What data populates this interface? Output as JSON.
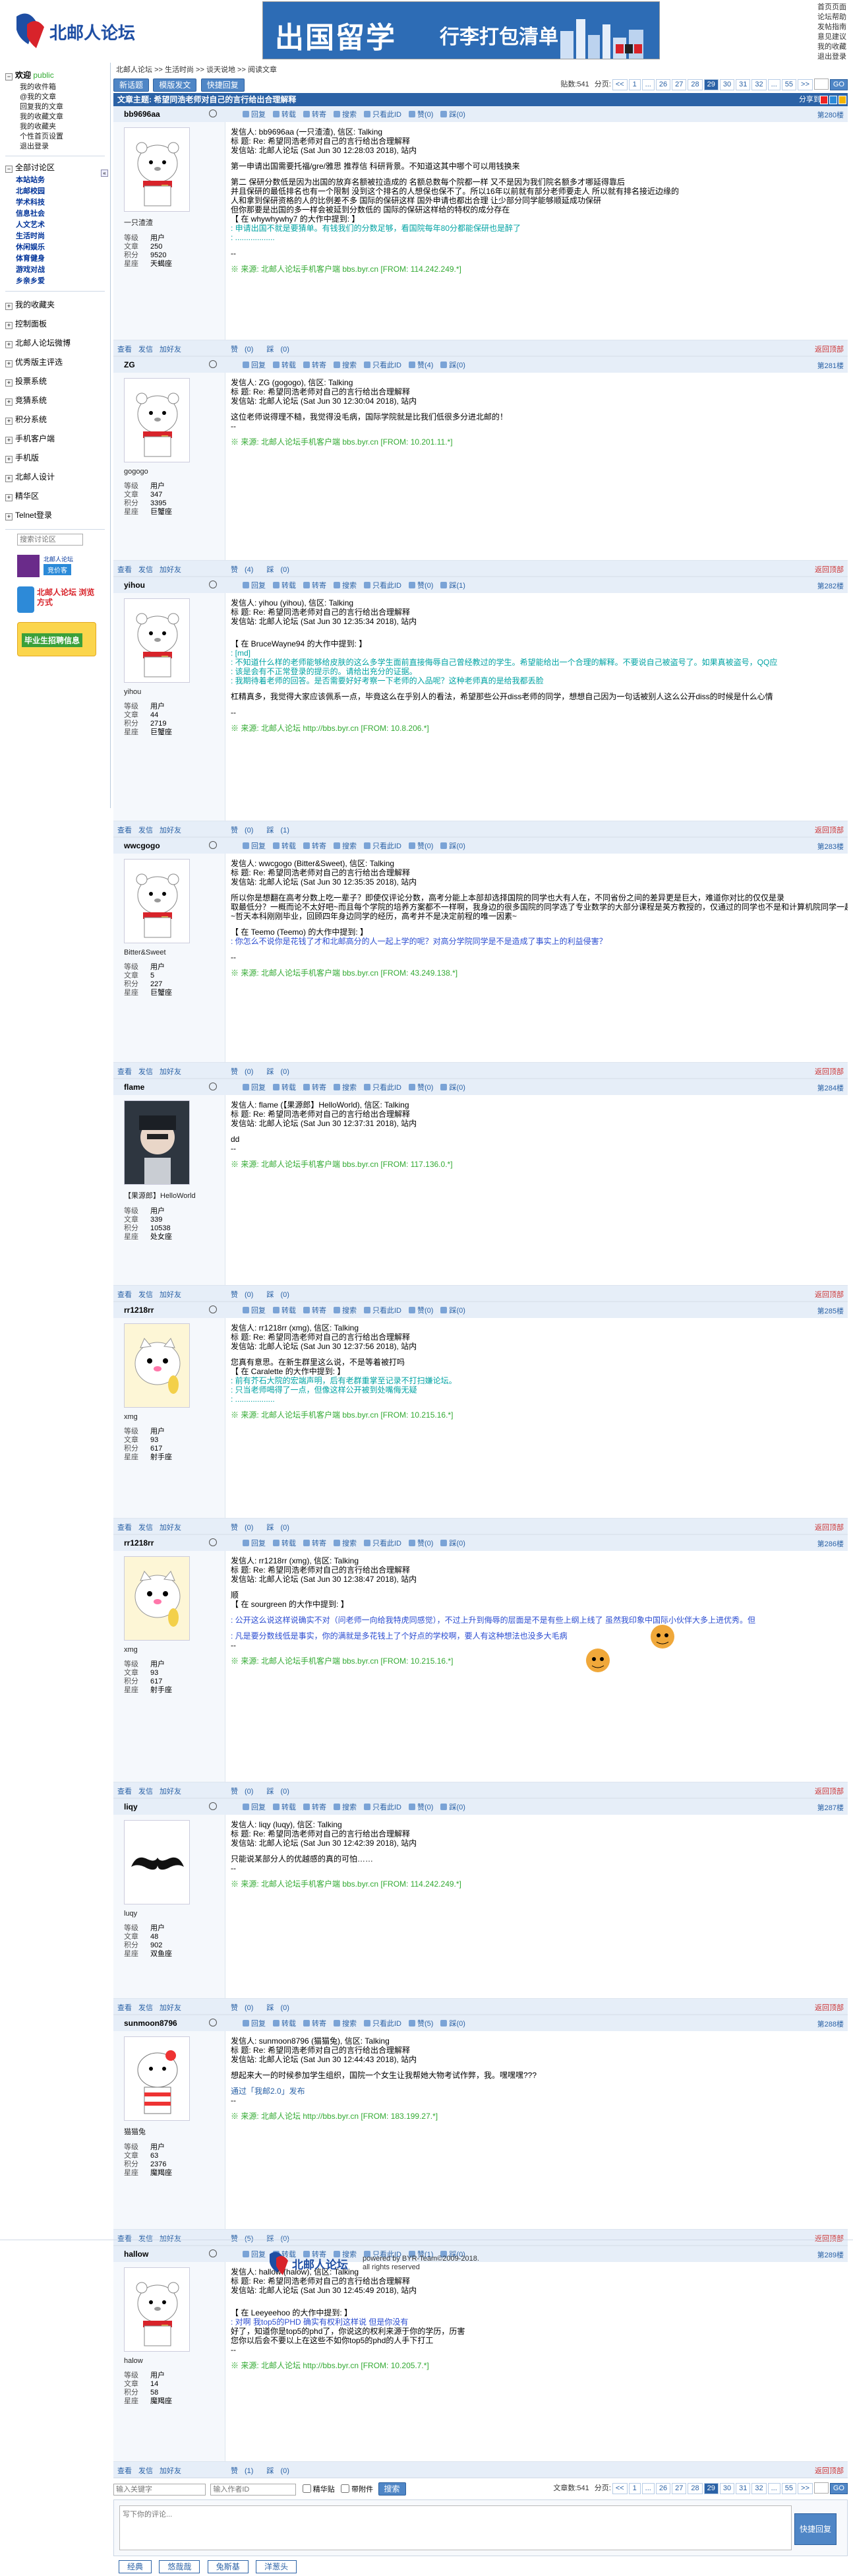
{
  "site": {
    "logo_text": "北邮人论坛",
    "banner": {
      "big": "出国留学",
      "small": "行李打包清单"
    },
    "top_links": [
      "首页页面",
      "论坛帮助",
      "发帖指南",
      "意见建议",
      "我的收藏",
      "退出登录"
    ]
  },
  "sidebar": {
    "welcome": "欢迎",
    "user": "public",
    "user_links": [
      "我的收件箱",
      "@我的文章",
      "回复我的文章",
      "我的收藏文章",
      "我的收藏夹",
      "个性首页设置",
      "退出登录"
    ],
    "sections_title": "全部讨论区",
    "sections": [
      "本站站务",
      "北邮校园",
      "学术科技",
      "信息社会",
      "人文艺术",
      "生活时尚",
      "休闲娱乐",
      "体育健身",
      "游戏对战",
      "乡亲乡爱"
    ],
    "menu": [
      "我的收藏夹",
      "控制面板",
      "北邮人论坛微博",
      "优秀版主评选",
      "投票系统",
      "竞猜系统",
      "积分系统",
      "手机客户端",
      "手机版",
      "北邮人设计",
      "精华区",
      "Telnet登录"
    ],
    "search_placeholder": "搜索讨论区",
    "ad1": "北邮人论坛",
    "ad1_btn": "竞价客",
    "ad2": "北邮人论坛 浏览方式",
    "ad3": "毕业生招聘信息"
  },
  "breadcrumb": [
    "北邮人论坛",
    ">>",
    "生活时尚",
    ">>",
    "谈天说地",
    ">>",
    "阅读文章"
  ],
  "toolbar": {
    "new": "新话题",
    "tpl": "模版发文",
    "quick": "快捷回复"
  },
  "pager": {
    "count_label": "贴数:541",
    "page_label": "分页:",
    "prev": "<<",
    "pages": [
      "1",
      "...",
      "26",
      "27",
      "28",
      "29",
      "30",
      "31",
      "32",
      "...",
      "55"
    ],
    "current": "29",
    "next": ">>",
    "go": "GO"
  },
  "thread": {
    "title": "文章主题: 希望同浩老师对自己的言行给出合理解释",
    "share": "分享到:"
  },
  "acts": [
    "回复",
    "转载",
    "转寄",
    "搜索",
    "只看此ID",
    "赞",
    "踩"
  ],
  "foot_left": [
    "查看",
    "发信",
    "加好友"
  ],
  "back_top": "返回顶部",
  "stat_labels": [
    "等级",
    "文章",
    "积分",
    "星座"
  ],
  "posts": [
    {
      "uid": "bb9696aa",
      "floor": "第280楼",
      "nick": "一只渣渣",
      "stats": [
        "用户",
        "250",
        "9520",
        "天蝎座"
      ],
      "up": "(0)",
      "down": "(0)",
      "fu": "(0)",
      "fd": "(0)",
      "lines": [
        {
          "c": "l",
          "t": "发信人: bb9696aa (一只渣渣), 信区: Talking"
        },
        {
          "c": "l",
          "t": "标 题: Re: 希望同浩老师对自己的言行给出合理解释"
        },
        {
          "c": "l",
          "t": "发信站: 北邮人论坛 (Sat Jun 30 12:28:03 2018), 站内"
        },
        {
          "c": "g",
          "t": ""
        },
        {
          "c": "l",
          "t": "第一申请出国需要托福/gre/雅思 推荐信 科研背景。不知道这其中哪个可以用钱换来"
        },
        {
          "c": "g",
          "t": ""
        },
        {
          "c": "l",
          "t": "第二 保研分数低是因为出国的放弃名额被拉造成的 名额总数每个院都一样 又不是因为我们院名额多才哪延得靠后"
        },
        {
          "c": "l",
          "t": "并且保研的最低排名也有一个限制 没到这个排名的人想保也保不了。所以16年以前就有部分老师要走人 所以就有排名接近边缘的"
        },
        {
          "c": "l",
          "t": "人和拿到保研资格的人的比例差不多 国际的保研这样 国外申请也都出合理 让少部分同学能够顺延成功保研"
        },
        {
          "c": "l",
          "t": "但你那要是出国的多一样会被延到分数低的 国际的保研这样给的特权的成分存在"
        },
        {
          "c": "l",
          "t": "【 在 whywhywhy7 的大作中提到: 】"
        },
        {
          "c": "q",
          "t": ": 申请出国不就是要猜单。有钱我们的分数足够，看国院每年80分都能保研也是醉了"
        },
        {
          "c": "q",
          "t": ": .................."
        },
        {
          "c": "g",
          "t": ""
        },
        {
          "c": "l",
          "t": "--"
        },
        {
          "c": "g",
          "t": ""
        },
        {
          "c": "src",
          "t": "※ 来源: 北邮人论坛手机客户端 bbs.byr.cn [FROM: 114.242.249.*]"
        }
      ]
    },
    {
      "uid": "ZG",
      "floor": "第281楼",
      "nick": "gogogo",
      "stats": [
        "用户",
        "347",
        "3395",
        "巨蟹座"
      ],
      "up": "(4)",
      "down": "(0)",
      "fu": "(4)",
      "fd": "(0)",
      "lines": [
        {
          "c": "l",
          "t": "发信人: ZG (gogogo), 信区: Talking"
        },
        {
          "c": "l",
          "t": "标 题: Re: 希望同浩老师对自己的言行给出合理解释"
        },
        {
          "c": "l",
          "t": "发信站: 北邮人论坛 (Sat Jun 30 12:30:04 2018), 站内"
        },
        {
          "c": "g",
          "t": ""
        },
        {
          "c": "l",
          "t": "这位老师说得理不糙，我觉得没毛病，国际学院就是比我们低很多分进北邮的！"
        },
        {
          "c": "l",
          "t": "--"
        },
        {
          "c": "g",
          "t": ""
        },
        {
          "c": "src",
          "t": "※ 来源: 北邮人论坛手机客户端 bbs.byr.cn [FROM: 10.201.11.*]"
        }
      ]
    },
    {
      "uid": "yihou",
      "floor": "第282楼",
      "nick": "yihou",
      "stats": [
        "用户",
        "44",
        "2719",
        "巨蟹座"
      ],
      "up": "(0)",
      "down": "(1)",
      "fu": "(0)",
      "fd": "(1)",
      "lines": [
        {
          "c": "l",
          "t": "发信人: yihou (yihou), 信区: Talking"
        },
        {
          "c": "l",
          "t": "标 题: Re: 希望同浩老师对自己的言行给出合理解释"
        },
        {
          "c": "l",
          "t": "发信站: 北邮人论坛 (Sat Jun 30 12:35:34 2018), 站内"
        },
        {
          "c": "g",
          "t": ""
        },
        {
          "c": "g",
          "t": ""
        },
        {
          "c": "l",
          "t": "【 在 BruceWayne94 的大作中提到: 】"
        },
        {
          "c": "q",
          "t": ": [md]"
        },
        {
          "c": "q",
          "t": ": 不知道什么样的老师能够给皮肤的这么多学生面前直接侮辱自己曾经教过的学生。希望能给出一个合理的解释。不要说自己被盗号了。如果真被盗号，QQ应"
        },
        {
          "c": "q",
          "t": ": 该是会有不正常登录的提示的。请给出充分的证据。"
        },
        {
          "c": "q",
          "t": ": 我期待着老师的回答。是否需要好好考察一下老师的入品呢？这种老师真的是给我都丢脸"
        },
        {
          "c": "g",
          "t": ""
        },
        {
          "c": "l",
          "t": "杠精真多，我觉得大家应该佩系一点，毕竟这么在乎别人的看法，希望那些公开diss老师的同学，想想自己因为一句话被别人这么公开diss的时候是什么心情"
        },
        {
          "c": "g",
          "t": ""
        },
        {
          "c": "l",
          "t": "--"
        },
        {
          "c": "g",
          "t": ""
        },
        {
          "c": "src",
          "t": "※ 来源: 北邮人论坛 http://bbs.byr.cn [FROM: 10.8.206.*]"
        }
      ]
    },
    {
      "uid": "wwcgogo",
      "floor": "第283楼",
      "nick": "Bitter&Sweet",
      "stats": [
        "用户",
        "5",
        "227",
        "巨蟹座"
      ],
      "up": "(0)",
      "down": "(0)",
      "fu": "(0)",
      "fd": "(0)",
      "lines": [
        {
          "c": "l",
          "t": "发信人: wwcgogo (Bitter&Sweet), 信区: Talking"
        },
        {
          "c": "l",
          "t": "标 题: Re: 希望同浩老师对自己的言行给出合理解释"
        },
        {
          "c": "l",
          "t": "发信站: 北邮人论坛 (Sat Jun 30 12:35:35 2018), 站内"
        },
        {
          "c": "g",
          "t": ""
        },
        {
          "c": "l",
          "t": "所以你是想翻在高考分数上吃一辈子？即使仅评论分数，高考分能上本部却选择国院的同学也大有人在，不同省份之间的差异更是巨大，难道你对比的仅仅是录"
        },
        {
          "c": "l",
          "t": "取最低分？一概而论不太好吧~而且每个学院的培养方案都不一样啊，我身边的很多国院的同学选了专业数学的大部分课程是英方教授的，仅通过的同学也不是和计算机院同学一起上课的吧"
        },
        {
          "c": "l",
          "t": "~哲天本科刚刚毕业，回顾四年身边同学的经历，高考并不是决定前程的唯一因素~"
        },
        {
          "c": "g",
          "t": ""
        },
        {
          "c": "l",
          "t": "【 在 Teemo (Teemo) 的大作中提到: 】"
        },
        {
          "c": "q2",
          "t": ": 你怎么不说你是花钱了才和北邮高分的人一起上学的呢？对高分学院同学是不是造成了事实上的利益侵害？"
        },
        {
          "c": "g",
          "t": ""
        },
        {
          "c": "l",
          "t": "--"
        },
        {
          "c": "g",
          "t": ""
        },
        {
          "c": "src",
          "t": "※ 来源: 北邮人论坛手机客户端 bbs.byr.cn [FROM: 43.249.138.*]"
        }
      ]
    },
    {
      "uid": "flame",
      "floor": "第284楼",
      "nick": "【果源郎】HelloWorld",
      "stats": [
        "用户",
        "339",
        "10538",
        "处女座"
      ],
      "up": "(0)",
      "down": "(0)",
      "fu": "(0)",
      "fd": "(0)",
      "lines": [
        {
          "c": "l",
          "t": "发信人: flame (【果源郎】HelloWorld), 信区: Talking"
        },
        {
          "c": "l",
          "t": "标 题: Re: 希望同浩老师对自己的言行给出合理解释"
        },
        {
          "c": "l",
          "t": "发信站: 北邮人论坛 (Sat Jun 30 12:37:31 2018), 站内"
        },
        {
          "c": "g",
          "t": ""
        },
        {
          "c": "l",
          "t": "dd"
        },
        {
          "c": "l",
          "t": "--"
        },
        {
          "c": "g",
          "t": ""
        },
        {
          "c": "src",
          "t": "※ 来源: 北邮人论坛手机客户端 bbs.byr.cn [FROM: 117.136.0.*]"
        }
      ]
    },
    {
      "uid": "rr1218rr",
      "floor": "第285楼",
      "nick": "xmg",
      "stats": [
        "用户",
        "93",
        "617",
        "射手座"
      ],
      "up": "(0)",
      "down": "(0)",
      "fu": "(0)",
      "fd": "(0)",
      "lines": [
        {
          "c": "l",
          "t": "发信人: rr1218rr (xmg), 信区: Talking"
        },
        {
          "c": "l",
          "t": "标 题: Re: 希望同浩老师对自己的言行给出合理解释"
        },
        {
          "c": "l",
          "t": "发信站: 北邮人论坛 (Sat Jun 30 12:37:56 2018), 站内"
        },
        {
          "c": "g",
          "t": ""
        },
        {
          "c": "l",
          "t": "您真有意思。在新生群里这么说，不是等着被打吗"
        },
        {
          "c": "l",
          "t": "【 在 Caralette 的大作中提到: 】"
        },
        {
          "c": "q",
          "t": ": 前有芥石大院的宏端声明，后有老群重掌至记录不打扫嫌论坛。"
        },
        {
          "c": "q",
          "t": ": 只当老师喝得了一点，但像这样公开被到处嘴侮无疑"
        },
        {
          "c": "q",
          "t": ": .................."
        },
        {
          "c": "g",
          "t": ""
        },
        {
          "c": "src",
          "t": "※ 来源: 北邮人论坛手机客户端 bbs.byr.cn [FROM: 10.215.16.*]"
        }
      ]
    },
    {
      "uid": "rr1218rr",
      "floor": "第286楼",
      "nick": "xmg",
      "stats": [
        "用户",
        "93",
        "617",
        "射手座"
      ],
      "up": "(0)",
      "down": "(0)",
      "fu": "(0)",
      "fd": "(0)",
      "lines": [
        {
          "c": "l",
          "t": "发信人: rr1218rr (xmg), 信区: Talking"
        },
        {
          "c": "l",
          "t": "标 题: Re: 希望同浩老师对自己的言行给出合理解释"
        },
        {
          "c": "l",
          "t": "发信站: 北邮人论坛 (Sat Jun 30 12:38:47 2018), 站内"
        },
        {
          "c": "g",
          "t": ""
        },
        {
          "c": "l",
          "t": "顺"
        },
        {
          "c": "l",
          "t": "【 在 sourgreen 的大作中提到: 】"
        },
        {
          "c": "g",
          "t": ""
        },
        {
          "c": "q2",
          "t": ": 公开这么说这样说确实不对（问老师一向给我特虎同感觉），不过上升到侮辱的层面是不是有些上纲上线了       虽然我印象中国际小伙伴大多上进优秀。但"
        },
        {
          "c": "g",
          "t": ""
        },
        {
          "c": "q2",
          "t": ": 凡是要分数线低是事实，你的满就是多花钱上了个好点的学校啊，要人有这种想法也没多大毛病"
        },
        {
          "c": "l",
          "t": "--"
        },
        {
          "c": "g",
          "t": ""
        },
        {
          "c": "src",
          "t": "※ 来源: 北邮人论坛手机客户端 bbs.byr.cn [FROM: 10.215.16.*]"
        }
      ]
    },
    {
      "uid": "liqy",
      "floor": "第287楼",
      "nick": "luqy",
      "stats": [
        "用户",
        "48",
        "902",
        "双鱼座"
      ],
      "up": "(0)",
      "down": "(0)",
      "fu": "(0)",
      "fd": "(0)",
      "lines": [
        {
          "c": "l",
          "t": "发信人: liqy (luqy), 信区: Talking"
        },
        {
          "c": "l",
          "t": "标 题: Re: 希望同浩老师对自己的言行给出合理解释"
        },
        {
          "c": "l",
          "t": "发信站: 北邮人论坛 (Sat Jun 30 12:42:39 2018), 站内"
        },
        {
          "c": "g",
          "t": ""
        },
        {
          "c": "l",
          "t": "只能说某部分人的优越感的真的可怕……"
        },
        {
          "c": "l",
          "t": "--"
        },
        {
          "c": "g",
          "t": ""
        },
        {
          "c": "src",
          "t": "※ 来源: 北邮人论坛手机客户端 bbs.byr.cn [FROM: 114.242.249.*]"
        }
      ]
    },
    {
      "uid": "sunmoon8796",
      "floor": "第288楼",
      "nick": "猫猫兔",
      "stats": [
        "用户",
        "63",
        "2376",
        "魔羯座"
      ],
      "up": "(5)",
      "down": "(0)",
      "fu": "(5)",
      "fd": "(0)",
      "lines": [
        {
          "c": "l",
          "t": "发信人: sunmoon8796 (猫猫兔), 信区: Talking"
        },
        {
          "c": "l",
          "t": "标 题: Re: 希望同浩老师对自己的言行给出合理解释"
        },
        {
          "c": "l",
          "t": "发信站: 北邮人论坛 (Sat Jun 30 12:44:43 2018), 站内"
        },
        {
          "c": "g",
          "t": ""
        },
        {
          "c": "l",
          "t": "想起来大一的时候参加学生组织，国院一个女生让我帮她大物考试作弊，我。嘿嘿嘿???"
        },
        {
          "c": "g",
          "t": ""
        },
        {
          "c": "blue",
          "t": "通过「我邮2.0」发布"
        },
        {
          "c": "l",
          "t": "--"
        },
        {
          "c": "g",
          "t": ""
        },
        {
          "c": "src",
          "t": "※ 来源: 北邮人论坛 http://bbs.byr.cn [FROM: 183.199.27.*]"
        }
      ]
    },
    {
      "uid": "hallow",
      "floor": "第289楼",
      "nick": "halow",
      "stats": [
        "用户",
        "14",
        "58",
        "魔羯座"
      ],
      "up": "(1)",
      "down": "(0)",
      "fu": "(1)",
      "fd": "(0)",
      "lines": [
        {
          "c": "l",
          "t": "发信人: hallow (halow), 信区: Talking"
        },
        {
          "c": "l",
          "t": "标 题: Re: 希望同浩老师对自己的言行给出合理解释"
        },
        {
          "c": "l",
          "t": "发信站: 北邮人论坛 (Sat Jun 30 12:45:49 2018), 站内"
        },
        {
          "c": "g",
          "t": ""
        },
        {
          "c": "g",
          "t": ""
        },
        {
          "c": "l",
          "t": "【 在 Leeyeehoo 的大作中提到: 】"
        },
        {
          "c": "q2",
          "t": ": 对啊 我top5的PHD 确实有权利这样说 但是你没有"
        },
        {
          "c": "l",
          "t": "好了，知道你是top5的phd了，你说这的权利来源于你的学历，历害"
        },
        {
          "c": "l",
          "t": "您你以后会不要以上在这些不如你top5的phd的人手下打工"
        },
        {
          "c": "l",
          "t": "--"
        },
        {
          "c": "g",
          "t": ""
        },
        {
          "c": "src",
          "t": "※ 来源: 北邮人论坛 http://bbs.byr.cn [FROM: 10.205.7.*]"
        }
      ]
    }
  ],
  "bottom": {
    "kw_placeholder": "输入关键字",
    "author_placeholder": "输入作者ID",
    "cb1": "精华贴",
    "cb2": "带附件",
    "search": "搜索",
    "count": "文章数:541"
  },
  "reply": {
    "placeholder": "写下你的评论...",
    "button": "快捷回复"
  },
  "tags": [
    "经典",
    "悠哉哉",
    "兔斯基",
    "洋葱头"
  ],
  "footer": {
    "line1": "powered by BYR-Team©2009-2018.",
    "line2": "all rights reserved"
  }
}
